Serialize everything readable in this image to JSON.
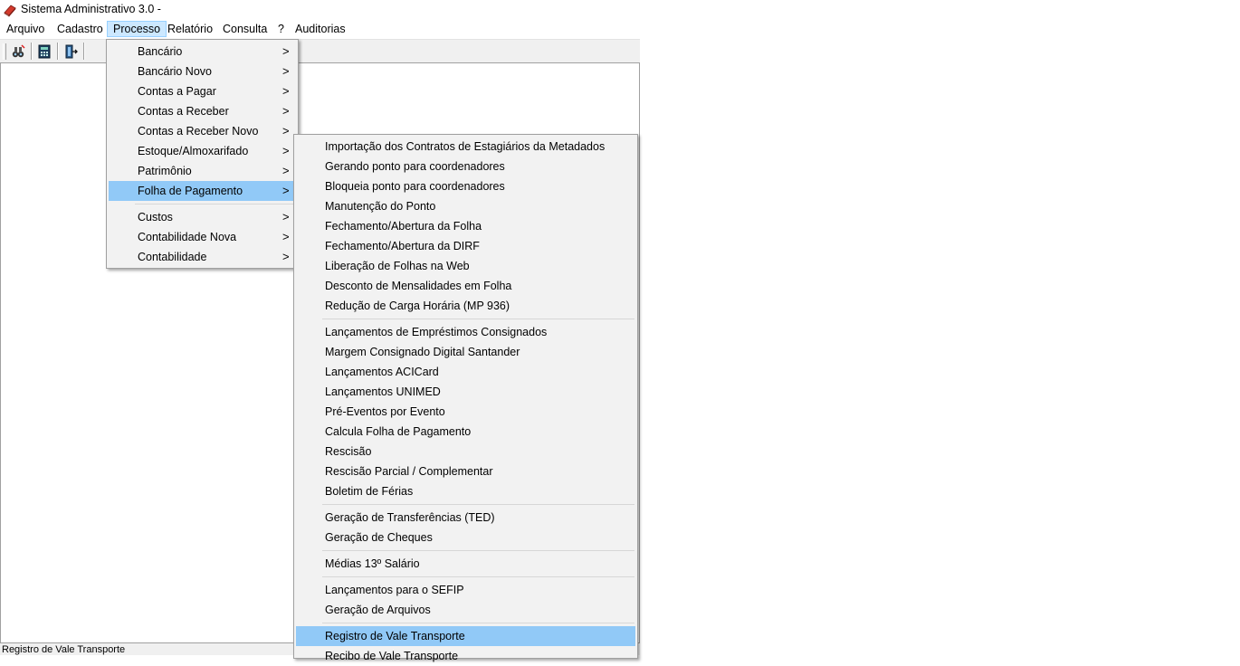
{
  "window": {
    "title": "Sistema Administrativo 3.0 -"
  },
  "menubar": {
    "items": [
      "Arquivo",
      "Cadastro",
      "Processo",
      "Relatório",
      "Consulta",
      "?",
      "Auditorias"
    ],
    "active": "Processo"
  },
  "toolbar": {
    "buttons": [
      {
        "icon": "search-binoculars-icon"
      },
      {
        "icon": "calculator-icon"
      },
      {
        "icon": "exit-door-icon"
      }
    ]
  },
  "statusbar": {
    "text": "Registro de Vale Transporte"
  },
  "processo_menu": {
    "items": [
      "Bancário",
      "Bancário Novo",
      "Contas a Pagar",
      "Contas a Receber",
      "Contas a Receber Novo",
      "Estoque/Almoxarifado",
      "Patrimônio",
      "Folha de Pagamento",
      "Custos",
      "Contabilidade Nova",
      "Contabilidade"
    ],
    "active": "Folha de Pagamento",
    "submenu_arrow": ">"
  },
  "folha_submenu": {
    "items": [
      "Importação dos Contratos de Estagiários da Metadados",
      "Gerando ponto para coordenadores",
      "Bloqueia ponto para coordenadores",
      "Manutenção do Ponto",
      "Fechamento/Abertura da Folha",
      "Fechamento/Abertura da DIRF",
      "Liberação de Folhas na Web",
      "Desconto de Mensalidades em Folha",
      "Redução de Carga Horária (MP 936)",
      "Lançamentos de Empréstimos Consignados",
      "Margem Consignado Digital Santander",
      "Lançamentos ACICard",
      "Lançamentos UNIMED",
      "Pré-Eventos por Evento",
      "Calcula Folha de Pagamento",
      "Rescisão",
      "Rescisão Parcial / Complementar",
      "Boletim de Férias",
      "Geração de Transferências (TED)",
      "Geração de Cheques",
      "Médias 13º Salário",
      "Lançamentos para o SEFIP",
      "Geração de Arquivos",
      "Registro de Vale Transporte",
      "Recibo de Vale Transporte"
    ],
    "active": "Registro de Vale Transporte"
  }
}
